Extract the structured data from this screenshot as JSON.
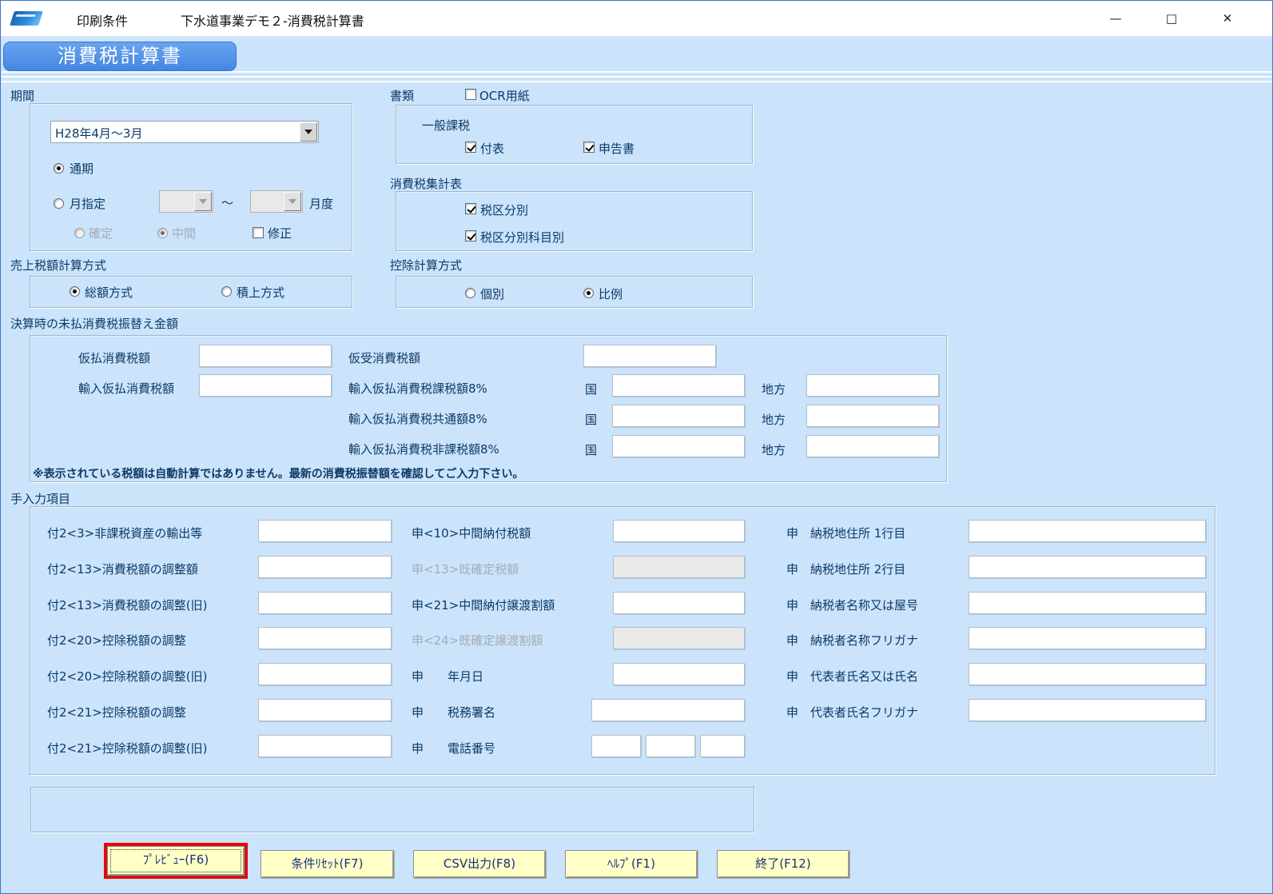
{
  "window": {
    "menu_label": "印刷条件",
    "title": "下水道事業デモ２-消費税計算書",
    "controls": {
      "minimize": "—",
      "maximize": "□",
      "close": "✕"
    }
  },
  "page": {
    "title": "消費税計算書"
  },
  "icons": {
    "app_logo": "app-logo-icon",
    "combo_arrow": "chevron-down-icon"
  },
  "colors": {
    "form_bg": "#cbe3fb",
    "tab_blue": "#4486e2",
    "button_yellow": "#ffffc6",
    "highlight_red": "#e60808",
    "text_navy": "#0e3a66"
  },
  "period": {
    "section_label": "期間",
    "selected": "H28年4月～3月",
    "full_period": "通期",
    "by_month": "月指定",
    "tilde": "～",
    "month_suffix": "月度",
    "fixed": "確定",
    "interim": "中間",
    "revision": "修正",
    "states": {
      "full_period": true,
      "by_month": false,
      "fixed": false,
      "interim": true,
      "revision": false
    }
  },
  "documents": {
    "section_label": "書類",
    "ocr": "OCR用紙",
    "group_title": "一般課税",
    "fuhyo": "付表",
    "shinkoku": "申告書",
    "states": {
      "ocr": false,
      "fuhyo": true,
      "shinkoku": true
    }
  },
  "summary": {
    "section_label": "消費税集計表",
    "by_tax_class": "税区分別",
    "by_tax_class_subject": "税区分別科目別",
    "states": {
      "by_tax_class": true,
      "by_tax_class_subject": true
    }
  },
  "sales": {
    "section_label": "売上税額計算方式",
    "total": "総額方式",
    "accumulate": "積上方式",
    "states": {
      "total": true,
      "accumulate": false
    }
  },
  "deduction": {
    "section_label": "控除計算方式",
    "individual": "個別",
    "proportional": "比例",
    "states": {
      "individual": false,
      "proportional": true
    }
  },
  "transfer": {
    "section_label": "決算時の未払消費税振替え金額",
    "karibarai_label": "仮払消費税額",
    "yunyu_karibarai_label": "輸入仮払消費税額",
    "kariuke_label": "仮受消費税額",
    "kazei8_label": "輸入仮払消費税課税額8%",
    "kyotsu8_label": "輸入仮払消費税共通額8%",
    "hikazei8_label": "輸入仮払消費税非課税額8%",
    "kuni_label": "国",
    "chiho_label": "地方",
    "values": {
      "all_fields": ""
    },
    "note": "※表示されている税額は自動計算ではありません。最新の消費税振替額を確認してご入力下さい。"
  },
  "manual": {
    "section_label": "手入力項目",
    "left_rows": [
      "付2<3>非課税資産の輸出等",
      "付2<13>消費税額の調整額",
      "付2<13>消費税額の調整(旧)",
      "付2<20>控除税額の調整",
      "付2<20>控除税額の調整(旧)",
      "付2<21>控除税額の調整",
      "付2<21>控除税額の調整(旧)"
    ],
    "middle_rows": [
      {
        "label": "申<10>中間納付税額",
        "disabled": false
      },
      {
        "label": "申<13>既確定税額",
        "disabled": true
      },
      {
        "label": "申<21>中間納付譲渡割額",
        "disabled": false
      },
      {
        "label": "申<24>既確定譲渡割額",
        "disabled": true
      },
      {
        "label": "申　　年月日",
        "disabled": false
      },
      {
        "label": "申　　税務署名",
        "disabled": false
      },
      {
        "label": "申　　電話番号",
        "disabled": false
      }
    ],
    "right_rows": [
      "申　納税地住所 1行目",
      "申　納税地住所 2行目",
      "申　納税者名称又は屋号",
      "申　納税者名称フリガナ",
      "申　代表者氏名又は氏名",
      "申　代表者氏名フリガナ"
    ]
  },
  "status_box": {
    "text": ""
  },
  "buttons": {
    "preview": "ﾌﾟﾚﾋﾞｭｰ(F6)",
    "reset": "条件ﾘｾｯﾄ(F7)",
    "csv": "CSV出力(F8)",
    "help": "ﾍﾙﾌﾟ(F1)",
    "exit": "終了(F12)"
  }
}
